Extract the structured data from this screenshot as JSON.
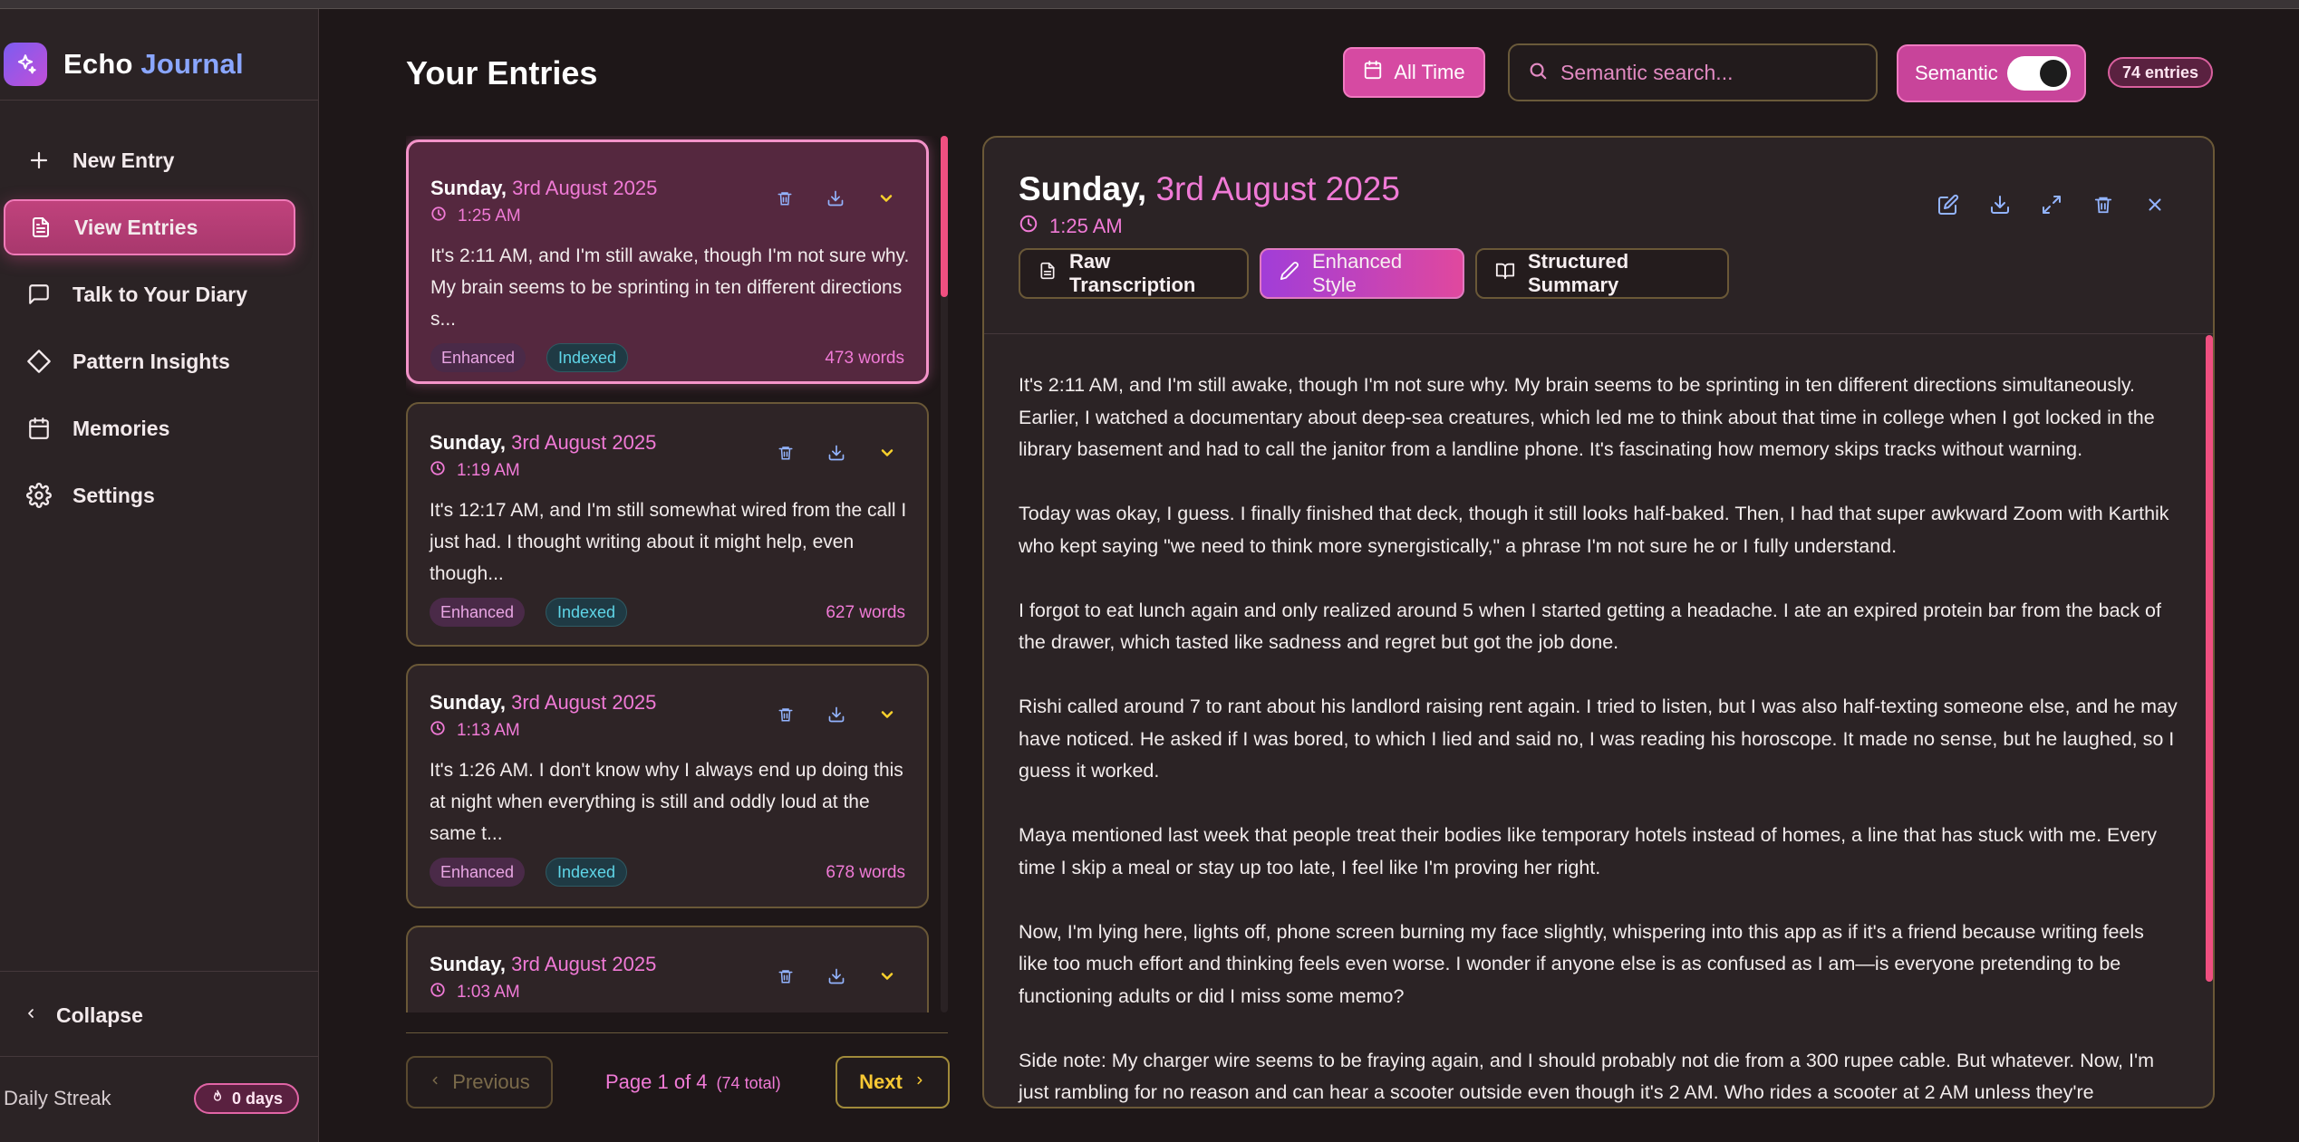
{
  "app": {
    "brand_prefix": "Echo",
    "brand_accent": "Journal",
    "accent_color": "#e04ea8"
  },
  "sidebar": {
    "items": [
      {
        "label": "New Entry",
        "icon": "plus-icon"
      },
      {
        "label": "View Entries",
        "icon": "file-text-icon",
        "active": true
      },
      {
        "label": "Talk to Your Diary",
        "icon": "chat-bubble-icon"
      },
      {
        "label": "Pattern Insights",
        "icon": "diamond-icon"
      },
      {
        "label": "Memories",
        "icon": "calendar-icon"
      },
      {
        "label": "Settings",
        "icon": "gear-icon"
      }
    ],
    "collapse_label": "Collapse",
    "streak_label": "Daily Streak",
    "streak_value": "0 days"
  },
  "header": {
    "title": "Your Entries",
    "time_filter": "All Time",
    "search_placeholder": "Semantic search...",
    "semantic_label": "Semantic",
    "semantic_on": true,
    "entries_count": "74 entries"
  },
  "entries": [
    {
      "day": "Sunday,",
      "date": "3rd August 2025",
      "time": "1:25 AM",
      "preview": "It's 2:11 AM, and I'm still awake, though I'm not sure why. My brain seems to be sprinting in ten different directions s...",
      "badge1": "Enhanced",
      "badge2": "Indexed",
      "words": "473 words",
      "selected": true
    },
    {
      "day": "Sunday,",
      "date": "3rd August 2025",
      "time": "1:19 AM",
      "preview": "It's 12:17 AM, and I'm still somewhat wired from the call I just had. I thought writing about it might help, even though...",
      "badge1": "Enhanced",
      "badge2": "Indexed",
      "words": "627 words"
    },
    {
      "day": "Sunday,",
      "date": "3rd August 2025",
      "time": "1:13 AM",
      "preview": "It's 1:26 AM. I don't know why I always end up doing this at night when everything is still and oddly loud at the same t...",
      "badge1": "Enhanced",
      "badge2": "Indexed",
      "words": "678 words"
    },
    {
      "day": "Sunday,",
      "date": "3rd August 2025",
      "time": "1:03 AM",
      "preview": "",
      "badge1": "",
      "badge2": "",
      "words": ""
    }
  ],
  "pagination": {
    "prev_label": "Previous",
    "page_label": "Page 1 of 4",
    "total_label": "(74 total)",
    "next_label": "Next"
  },
  "detail": {
    "day": "Sunday,",
    "date": "3rd August 2025",
    "time": "1:25 AM",
    "tabs": [
      "Raw Transcription",
      "Enhanced Style",
      "Structured Summary"
    ],
    "active_tab": "Enhanced Style",
    "paragraphs": [
      "It's 2:11 AM, and I'm still awake, though I'm not sure why. My brain seems to be sprinting in ten different directions simultaneously. Earlier, I watched a documentary about deep-sea creatures, which led me to think about that time in college when I got locked in the library basement and had to call the janitor from a landline phone. It's fascinating how memory skips tracks without warning.",
      "Today was okay, I guess. I finally finished that deck, though it still looks half-baked. Then, I had that super awkward Zoom with Karthik who kept saying \"we need to think more synergistically,\" a phrase I'm not sure he or I fully understand.",
      "I forgot to eat lunch again and only realized around 5 when I started getting a headache. I ate an expired protein bar from the back of the drawer, which tasted like sadness and regret but got the job done.",
      "Rishi called around 7 to rant about his landlord raising rent again. I tried to listen, but I was also half-texting someone else, and he may have noticed. He asked if I was bored, to which I lied and said no, I was reading his horoscope. It made no sense, but he laughed, so I guess it worked.",
      "Maya mentioned last week that people treat their bodies like temporary hotels instead of homes, a line that has stuck with me. Every time I skip a meal or stay up too late, I feel like I'm proving her right.",
      "Now, I'm lying here, lights off, phone screen burning my face slightly, whispering into this app as if it's a friend because writing feels like too much effort and thinking feels even worse. I wonder if anyone else is as confused as I am—is everyone pretending to be functioning adults or did I miss some memo?",
      "Side note: My charger wire seems to be fraying again, and I should probably not die from a 300 rupee cable. But whatever. Now, I'm just rambling for no reason and can hear a scooter outside even though it's 2 AM. Who rides a scooter at 2 AM unless they're"
    ]
  }
}
